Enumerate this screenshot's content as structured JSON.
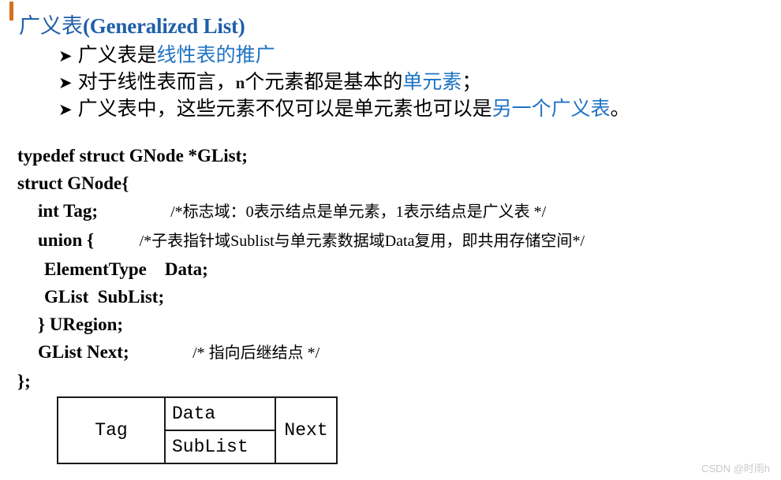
{
  "slide": {
    "title_cn": "广义表",
    "title_en": "(Generalized List)",
    "title_color": "#1F5FA8",
    "accent_color": "#D4721A",
    "highlight_color": "#1F73C4"
  },
  "bullets": [
    {
      "marker": "➤",
      "parts": [
        {
          "text": "广义表是",
          "color": "black"
        },
        {
          "text": "线性表的推广",
          "color": "blue"
        }
      ]
    },
    {
      "marker": "➤",
      "parts": [
        {
          "text": "对于线性表而言，",
          "color": "black"
        },
        {
          "text": "n",
          "color": "var"
        },
        {
          "text": "个元素都是基本的",
          "color": "black"
        },
        {
          "text": "单元素",
          "color": "blue"
        },
        {
          "text": "；",
          "color": "black"
        }
      ]
    },
    {
      "marker": "➤",
      "parts": [
        {
          "text": "广义表中，这些元素不仅可以是单元素也可以是",
          "color": "black"
        },
        {
          "text": "另一个广义表",
          "color": "blue"
        },
        {
          "text": "。",
          "color": "black"
        }
      ]
    }
  ],
  "code": {
    "lines": [
      {
        "indent": 0,
        "text": "typedef struct GNode *GList;",
        "comment": ""
      },
      {
        "indent": 0,
        "text": "struct GNode{",
        "comment": ""
      },
      {
        "indent": 1,
        "text": "int Tag;",
        "comment": "/*标志域：0表示结点是单元素，1表示结点是广义表 */",
        "gap": "                "
      },
      {
        "indent": 1,
        "text": "union {",
        "comment": "/*子表指针域Sublist与单元素数据域Data复用，即共用存储空间*/",
        "gap": "          "
      },
      {
        "indent": 2,
        "text": "ElementType    Data;",
        "comment": ""
      },
      {
        "indent": 2,
        "text": "GList  SubList;",
        "comment": ""
      },
      {
        "indent": 1,
        "text": "} URegion;",
        "comment": ""
      },
      {
        "indent": 1,
        "text": "GList Next;",
        "comment": "/* 指向后继结点 */",
        "gap": "              "
      },
      {
        "indent": 0,
        "text": "};",
        "comment": ""
      }
    ]
  },
  "node_diagram": {
    "tag_label": "Tag",
    "data_label": "Data",
    "sublist_label": "SubList",
    "next_label": "Next"
  },
  "watermark": "CSDN @时雨h"
}
